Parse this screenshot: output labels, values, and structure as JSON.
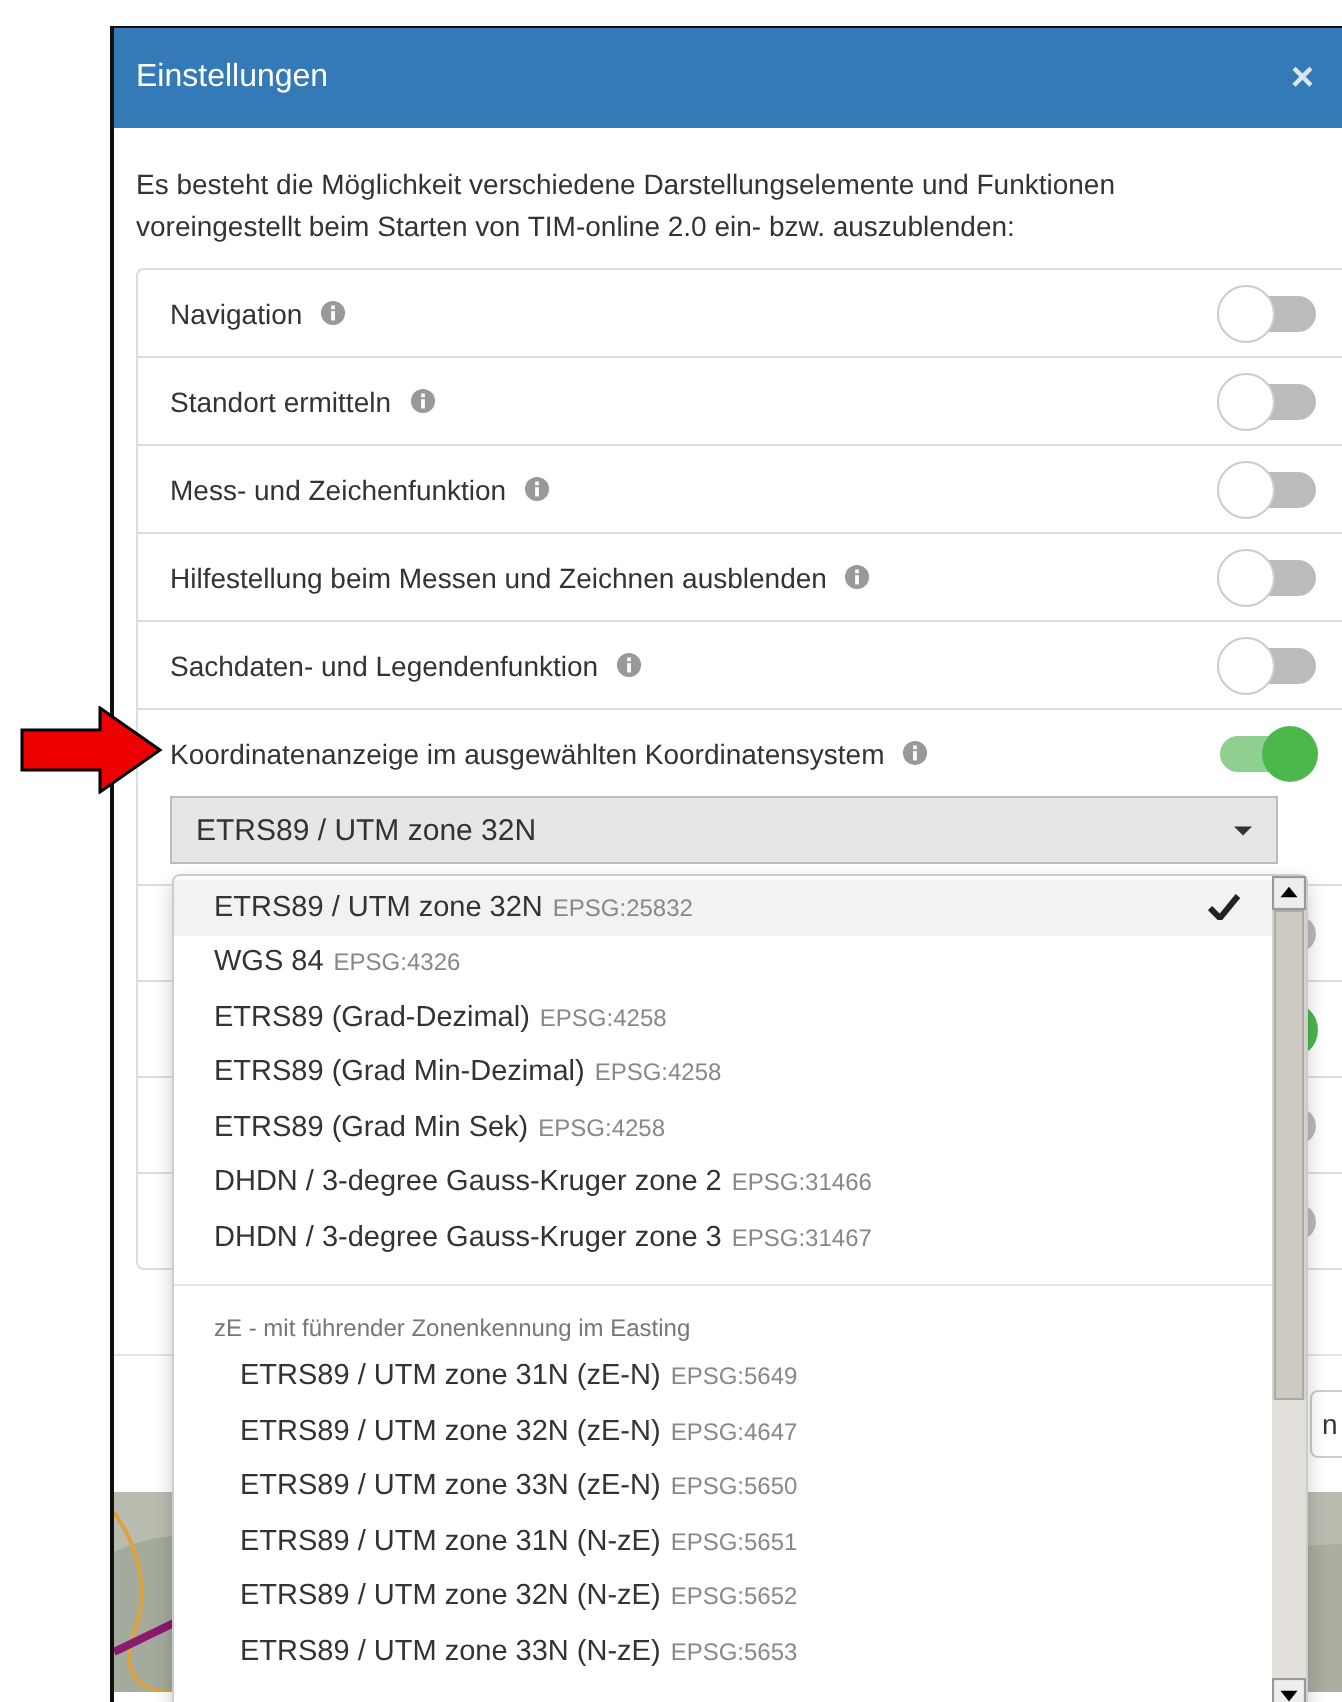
{
  "dialog": {
    "title": "Einstellungen",
    "close": "×",
    "intro": "Es besteht die Möglichkeit verschiedene Darstellungselemente und Funktionen voreingestellt beim Starten von TIM-online 2.0 ein- bzw. auszublenden:",
    "settings": [
      {
        "label": "Navigation",
        "on": false
      },
      {
        "label": "Standort ermitteln",
        "on": false
      },
      {
        "label": "Mess- und Zeichenfunktion",
        "on": false
      },
      {
        "label": "Hilfestellung beim Messen und Zeichnen ausblenden",
        "on": false
      },
      {
        "label": "Sachdaten- und Legendenfunktion",
        "on": false
      },
      {
        "label": "Koordinatenanzeige im ausgewählten Koordinatensystem",
        "on": true
      }
    ],
    "hidden_settings": [
      {
        "on": false
      },
      {
        "on": true
      },
      {
        "on": false
      },
      {
        "on": false
      }
    ],
    "footer_button": "n"
  },
  "select": {
    "value": "ETRS89 / UTM zone 32N"
  },
  "menu": [
    {
      "kind": "option",
      "label": "ETRS89 / UTM zone 32N",
      "code": "EPSG:25832",
      "selected": true
    },
    {
      "kind": "option",
      "label": "WGS 84",
      "code": "EPSG:4326",
      "selected": false
    },
    {
      "kind": "option",
      "label": "ETRS89 (Grad-Dezimal)",
      "code": "EPSG:4258",
      "selected": false
    },
    {
      "kind": "option",
      "label": "ETRS89 (Grad Min-Dezimal)",
      "code": "EPSG:4258",
      "selected": false
    },
    {
      "kind": "option",
      "label": "ETRS89 (Grad Min Sek)",
      "code": "EPSG:4258",
      "selected": false
    },
    {
      "kind": "option",
      "label": "DHDN / 3-degree Gauss-Kruger zone 2",
      "code": "EPSG:31466",
      "selected": false
    },
    {
      "kind": "option",
      "label": "DHDN / 3-degree Gauss-Kruger zone 3",
      "code": "EPSG:31467",
      "selected": false
    },
    {
      "kind": "group",
      "label": "zE - mit führender Zonenkennung im Easting"
    },
    {
      "kind": "suboption",
      "label": "ETRS89 / UTM zone 31N (zE-N)",
      "code": "EPSG:5649",
      "selected": false
    },
    {
      "kind": "suboption",
      "label": "ETRS89 / UTM zone 32N (zE-N)",
      "code": "EPSG:4647",
      "selected": false
    },
    {
      "kind": "suboption",
      "label": "ETRS89 / UTM zone 33N (zE-N)",
      "code": "EPSG:5650",
      "selected": false
    },
    {
      "kind": "suboption",
      "label": "ETRS89 / UTM zone 31N (N-zE)",
      "code": "EPSG:5651",
      "selected": false
    },
    {
      "kind": "suboption",
      "label": "ETRS89 / UTM zone 32N (N-zE)",
      "code": "EPSG:5652",
      "selected": false
    },
    {
      "kind": "suboption",
      "label": "ETRS89 / UTM zone 33N (N-zE)",
      "code": "EPSG:5653",
      "selected": false
    }
  ]
}
